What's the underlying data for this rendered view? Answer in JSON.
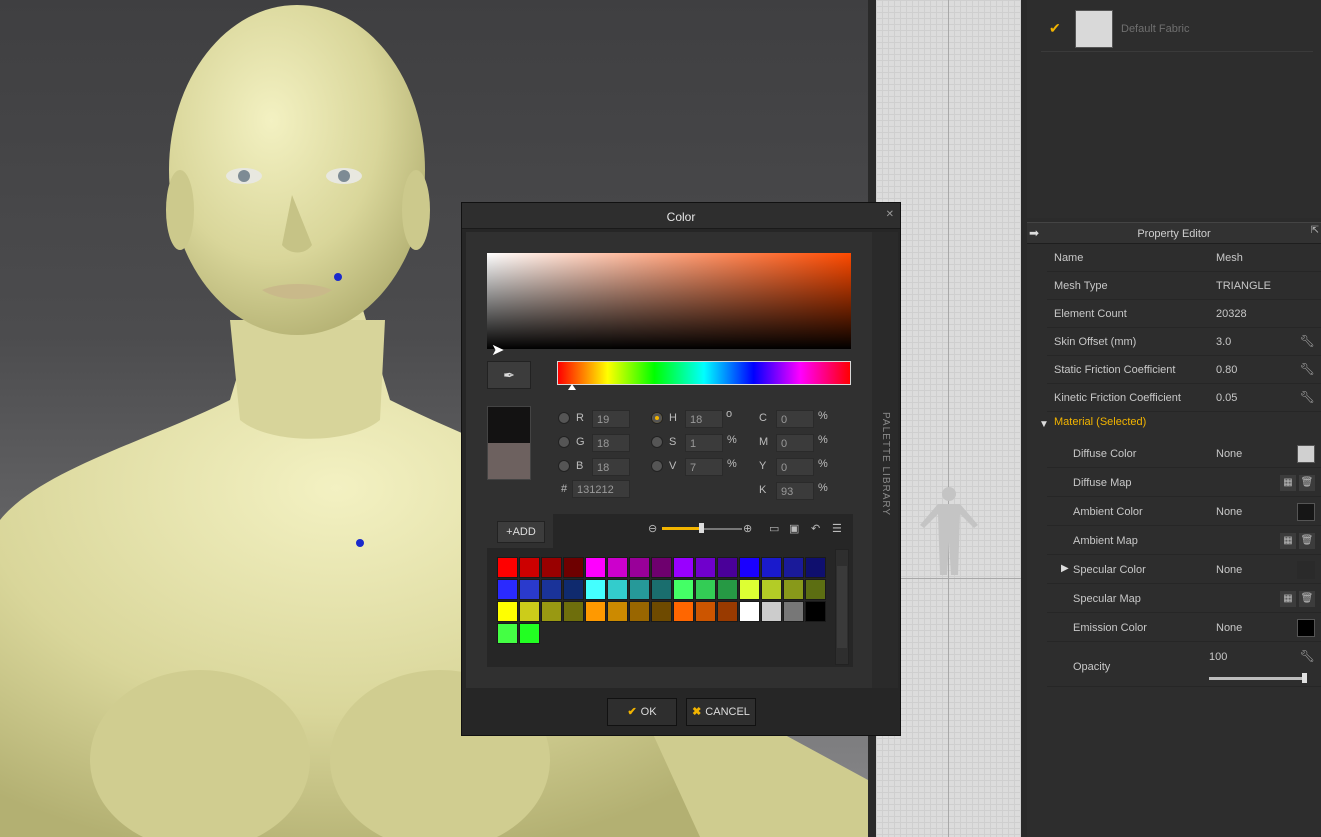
{
  "object_browser": {
    "fabric": {
      "name": "Default Fabric",
      "checked": true
    }
  },
  "property_editor": {
    "title": "Property Editor",
    "rows": [
      {
        "label": "Name",
        "value": "Mesh"
      },
      {
        "label": "Mesh Type",
        "value": "TRIANGLE"
      },
      {
        "label": "Element Count",
        "value": "20328"
      },
      {
        "label": "Skin Offset (mm)",
        "value": "3.0"
      },
      {
        "label": "Static Friction Coefficient",
        "value": "0.80"
      },
      {
        "label": "Kinetic Friction Coefficient",
        "value": "0.05"
      }
    ],
    "material_header": "Material (Selected)",
    "material_rows": [
      {
        "label": "Diffuse Color",
        "value": "None",
        "swatch": "#d0d0d0"
      },
      {
        "label": "Diffuse Map",
        "value": ""
      },
      {
        "label": "Ambient Color",
        "value": "None",
        "swatch": "#161616"
      },
      {
        "label": "Ambient Map",
        "value": ""
      },
      {
        "label": "Specular Color",
        "value": "None",
        "swatch": "#2a2a2a"
      },
      {
        "label": "Specular Map",
        "value": ""
      },
      {
        "label": "Emission Color",
        "value": "None",
        "swatch": "#000000"
      },
      {
        "label": "Opacity",
        "value": "100"
      }
    ],
    "opacity_level": 1.0
  },
  "color_dialog": {
    "title": "Color",
    "side_tab": "PALETTE LIBRARY",
    "rgb": {
      "r_label": "R",
      "r": "19",
      "g_label": "G",
      "g": "18",
      "b_label": "B",
      "b": "18"
    },
    "hsv": {
      "h_label": "H",
      "h": "18",
      "h_unit": "o",
      "s_label": "S",
      "s": "1",
      "s_unit": "%",
      "v_label": "V",
      "v": "7",
      "v_unit": "%"
    },
    "cmyk": {
      "c_label": "C",
      "c": "0",
      "m_label": "M",
      "m": "0",
      "y_label": "Y",
      "y": "0",
      "k_label": "K",
      "k": "93",
      "unit": "%"
    },
    "hex_label": "#",
    "hex": "131212",
    "new_color": "#131212",
    "old_color": "#6d615f",
    "hue_degrees": 18,
    "add_label": "+ADD",
    "zoom_level": 0.5,
    "palette": [
      "#ff0000",
      "#cc0000",
      "#990000",
      "#6e0000",
      "#ff00ff",
      "#cc00cc",
      "#990099",
      "#6e006e",
      "#9900ff",
      "#7000cc",
      "#4a0099",
      "#1a00ff",
      "#1a1acc",
      "#1a1a99",
      "#0f0f6e",
      "#2a2aff",
      "#2a3acc",
      "#1a3399",
      "#0f2a6e",
      "#44ffff",
      "#33cccc",
      "#269999",
      "#1a6e6e",
      "#44ff66",
      "#33cc55",
      "#269944",
      "#ddff33",
      "#b3cc26",
      "#88991a",
      "#5c6e12",
      "#ffff00",
      "#cccc1a",
      "#999912",
      "#6e6e0c",
      "#ff9900",
      "#cc8a00",
      "#996600",
      "#6e4a00",
      "#ff6600",
      "#cc5500",
      "#993a00",
      "#ffffff",
      "#cccccc",
      "#777777",
      "#000000",
      "#44ff44",
      "#22ff22"
    ],
    "ok_label": "OK",
    "cancel_label": "CANCEL"
  }
}
